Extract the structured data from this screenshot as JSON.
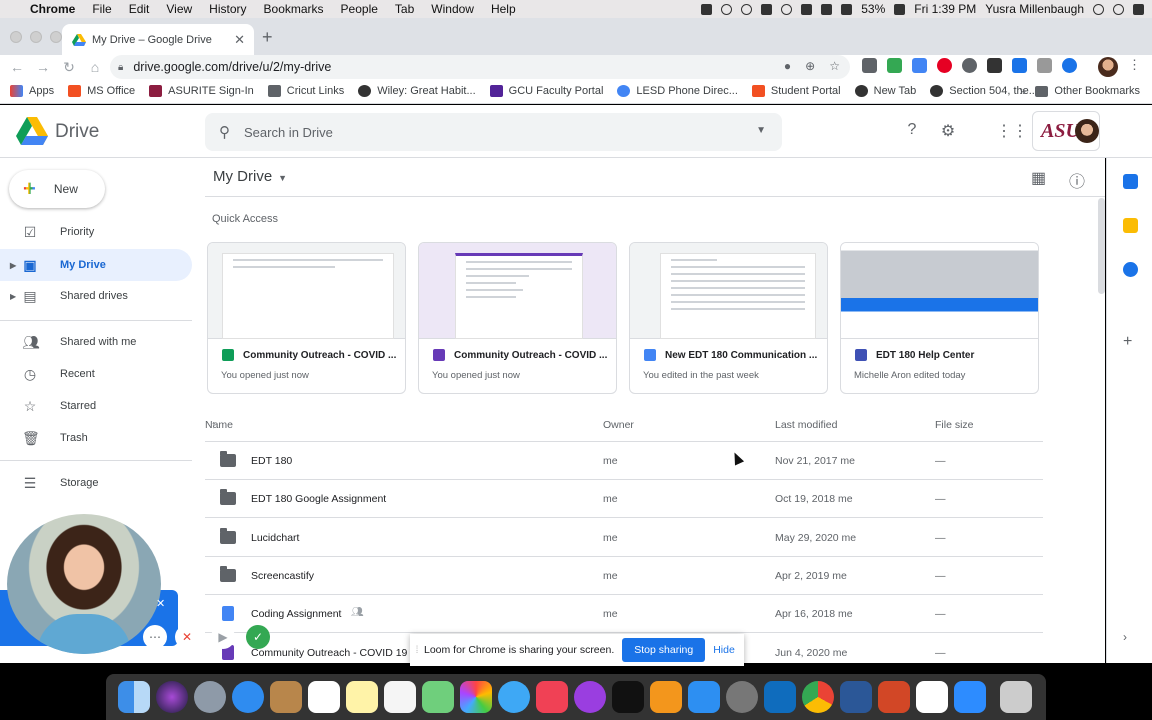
{
  "menubar": {
    "app": "Chrome",
    "items": [
      "File",
      "Edit",
      "View",
      "History",
      "Bookmarks",
      "People",
      "Tab",
      "Window",
      "Help"
    ],
    "battery": "53%",
    "clock": "Fri 1:39 PM",
    "user": "Yusra Millenbaugh"
  },
  "browser": {
    "tab_title": "My Drive – Google Drive",
    "url": "drive.google.com/drive/u/2/my-drive"
  },
  "bookmarks": {
    "items": [
      {
        "label": "Apps",
        "color": "#ea4335"
      },
      {
        "label": "MS Office",
        "color": "#f25022"
      },
      {
        "label": "ASURITE Sign-In",
        "color": "#8c1d40"
      },
      {
        "label": "Cricut Links",
        "color": "#5f6368"
      },
      {
        "label": "Wiley: Great Habit...",
        "color": "#333333"
      },
      {
        "label": "GCU Faculty Portal",
        "color": "#522398"
      },
      {
        "label": "LESD Phone Direc...",
        "color": "#4285f4"
      },
      {
        "label": "Student Portal",
        "color": "#f25022"
      },
      {
        "label": "New Tab",
        "color": "#333333"
      },
      {
        "label": "Section 504, the...",
        "color": "#333333"
      }
    ],
    "other": "Other Bookmarks"
  },
  "drive": {
    "logo_text": "Drive",
    "search_placeholder": "Search in Drive",
    "new_label": "New",
    "sidebar": {
      "priority": "Priority",
      "my_drive": "My Drive",
      "shared_drives": "Shared drives",
      "shared_with_me": "Shared with me",
      "recent": "Recent",
      "starred": "Starred",
      "trash": "Trash",
      "storage": "Storage"
    },
    "breadcrumb": "My Drive",
    "quick_access_title": "Quick Access",
    "quick_access": [
      {
        "title": "Community Outreach - COVID ...",
        "subtitle": "You opened just now",
        "icon_color": "#0f9d58"
      },
      {
        "title": "Community Outreach - COVID ...",
        "subtitle": "You opened just now",
        "icon_color": "#673ab7"
      },
      {
        "title": "New EDT 180 Communication ...",
        "subtitle": "You edited in the past week",
        "icon_color": "#4285f4"
      },
      {
        "title": "EDT 180 Help Center",
        "subtitle": "Michelle Aron edited today",
        "icon_color": "#3f51b5"
      }
    ],
    "columns": {
      "name": "Name",
      "owner": "Owner",
      "modified": "Last modified",
      "size": "File size"
    },
    "files": [
      {
        "name": "EDT 180",
        "owner": "me",
        "modified": "Nov 21, 2017  me",
        "size": "—",
        "icon": "shared-folder"
      },
      {
        "name": "EDT 180 Google Assignment",
        "owner": "me",
        "modified": "Oct 19, 2018  me",
        "size": "—",
        "icon": "shared-folder"
      },
      {
        "name": "Lucidchart",
        "owner": "me",
        "modified": "May 29, 2020  me",
        "size": "—",
        "icon": "folder"
      },
      {
        "name": "Screencastify",
        "owner": "me",
        "modified": "Apr 2, 2019  me",
        "size": "—",
        "icon": "folder"
      },
      {
        "name": "Coding Assignment",
        "owner": "me",
        "modified": "Apr 16, 2018  me",
        "size": "—",
        "icon": "doc"
      },
      {
        "name": "Community Outreach - COVID 19",
        "owner": "me",
        "modified": "Jun 4, 2020  me",
        "size": "—",
        "icon": "form"
      }
    ]
  },
  "loom": {
    "message": "Loom for Chrome is sharing your screen.",
    "stop": "Stop sharing",
    "hide": "Hide"
  }
}
